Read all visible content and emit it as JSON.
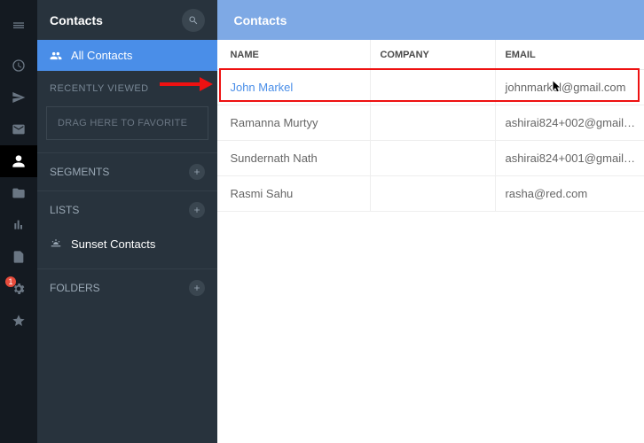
{
  "sidebar": {
    "title": "Contacts",
    "all_contacts": "All Contacts",
    "recently_viewed": "RECENTLY VIEWED",
    "dropzone": "DRAG HERE TO FAVORITE",
    "segments": "SEGMENTS",
    "lists": "LISTS",
    "list_item_1": "Sunset Contacts",
    "folders": "FOLDERS"
  },
  "rail": {
    "badge": "1"
  },
  "main": {
    "title": "Contacts",
    "columns": {
      "name": "NAME",
      "company": "COMPANY",
      "email": "EMAIL"
    },
    "rows": [
      {
        "name": "John Markel",
        "company": "",
        "email": "johnmarkel@gmail.com"
      },
      {
        "name": "Ramanna Murtyy",
        "company": "",
        "email": "ashirai824+002@gmail…"
      },
      {
        "name": "Sundernath Nath",
        "company": "",
        "email": "ashirai824+001@gmail…"
      },
      {
        "name": "Rasmi Sahu",
        "company": "",
        "email": "rasha@red.com"
      }
    ]
  }
}
